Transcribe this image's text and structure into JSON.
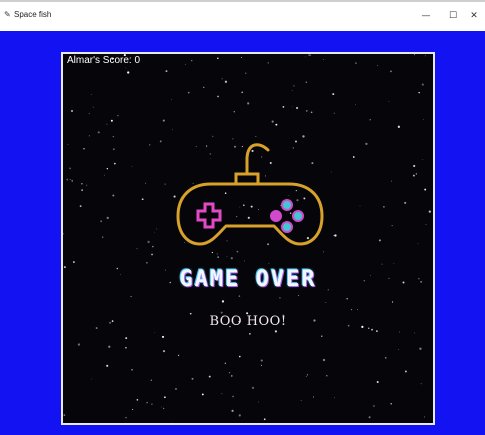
{
  "window": {
    "title": "Space fish",
    "app_icon": "feather-icon",
    "controls": {
      "minimize_glyph": "—",
      "maximize_glyph": "☐",
      "close_glyph": "✕"
    }
  },
  "game": {
    "score_text": "Almar's Score: 0",
    "game_over_text": "GAME OVER",
    "subtitle_text": "BOO HOO!",
    "icon": "gamepad-icon"
  },
  "colors": {
    "background_blue": "#1212f2",
    "space_black": "#06060a",
    "controller_gold": "#d8a12b",
    "dpad_pink": "#e44ac7",
    "button_cyan": "#41c6d2",
    "button_magenta": "#d24acb"
  }
}
